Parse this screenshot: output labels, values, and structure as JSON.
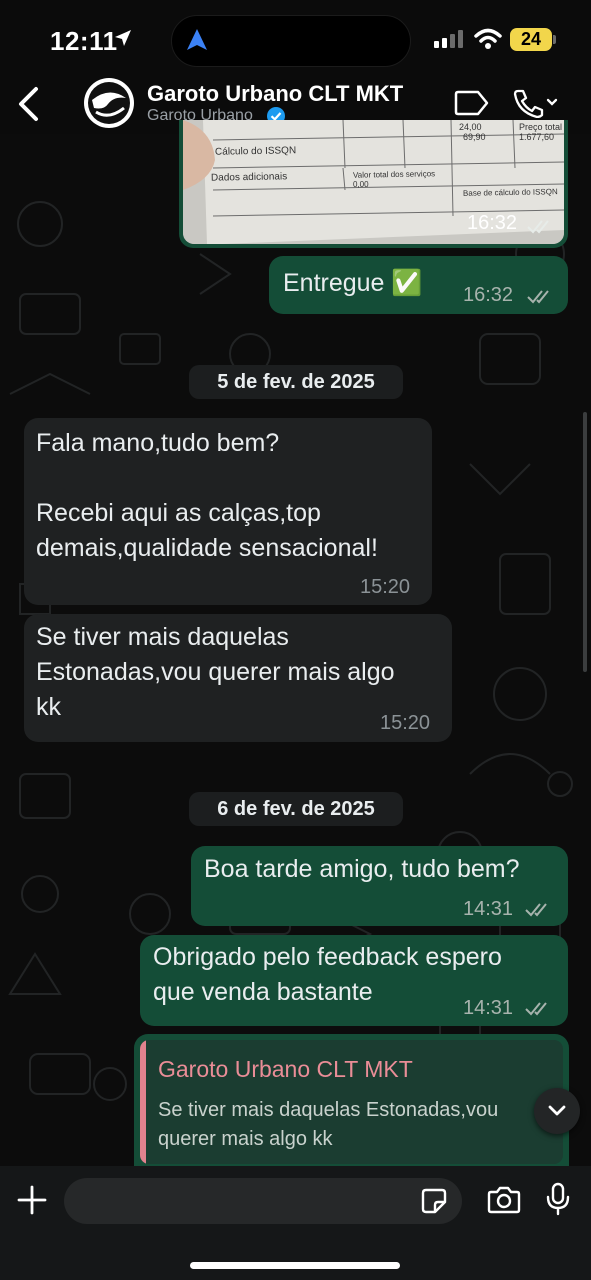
{
  "status_bar": {
    "time": "12:11",
    "battery": "24"
  },
  "header": {
    "title": "Garoto Urbano CLT MKT",
    "subtitle": "Garoto Urbano"
  },
  "colors": {
    "outgoing_bubble": "#144d37",
    "incoming_bubble": "#1f2122",
    "quote_author": "#ea8d97",
    "verified": "#1d9bf0",
    "battery": "#f2d64b"
  },
  "messages": {
    "image": {
      "time": "16:32"
    },
    "entregue": {
      "text": "Entregue ✅",
      "time": "16:32"
    },
    "date1": "5 de fev. de 2025",
    "in1": {
      "text": "Fala mano,tudo bem?\n\nRecebi aqui as calças,top\ndemais,qualidade sensacional!",
      "time": "15:20"
    },
    "in2": {
      "text": "Se tiver mais daquelas\nEstonadas,vou querer mais algo\nkk",
      "time": "15:20"
    },
    "date2": "6 de fev. de 2025",
    "out1": {
      "text": "Boa tarde amigo, tudo bem?",
      "time": "14:31"
    },
    "out2": {
      "text": "Obrigado pelo feedback espero\nque venda bastante",
      "time": "14:31"
    },
    "quote": {
      "author": "Garoto Urbano CLT MKT",
      "text": "Se tiver mais daquelas Estonadas,vou\nquerer mais algo kk"
    }
  },
  "receipt": {
    "lines": [
      "Cálculo do ISSQN",
      "Dados adicionais",
      "Valor total dos serviços",
      "0,00",
      "Base de cálculo do ISSQN",
      "Preço total",
      "1.677,60",
      "24,00",
      "69,90"
    ]
  },
  "input": {
    "placeholder": ""
  },
  "icons": [
    "back-icon",
    "avatar-logo",
    "verified-icon",
    "video-call-icon",
    "phone-call-icon",
    "plus-icon",
    "sticker-icon",
    "camera-icon",
    "mic-icon",
    "chevron-down-icon",
    "double-check-icon"
  ]
}
